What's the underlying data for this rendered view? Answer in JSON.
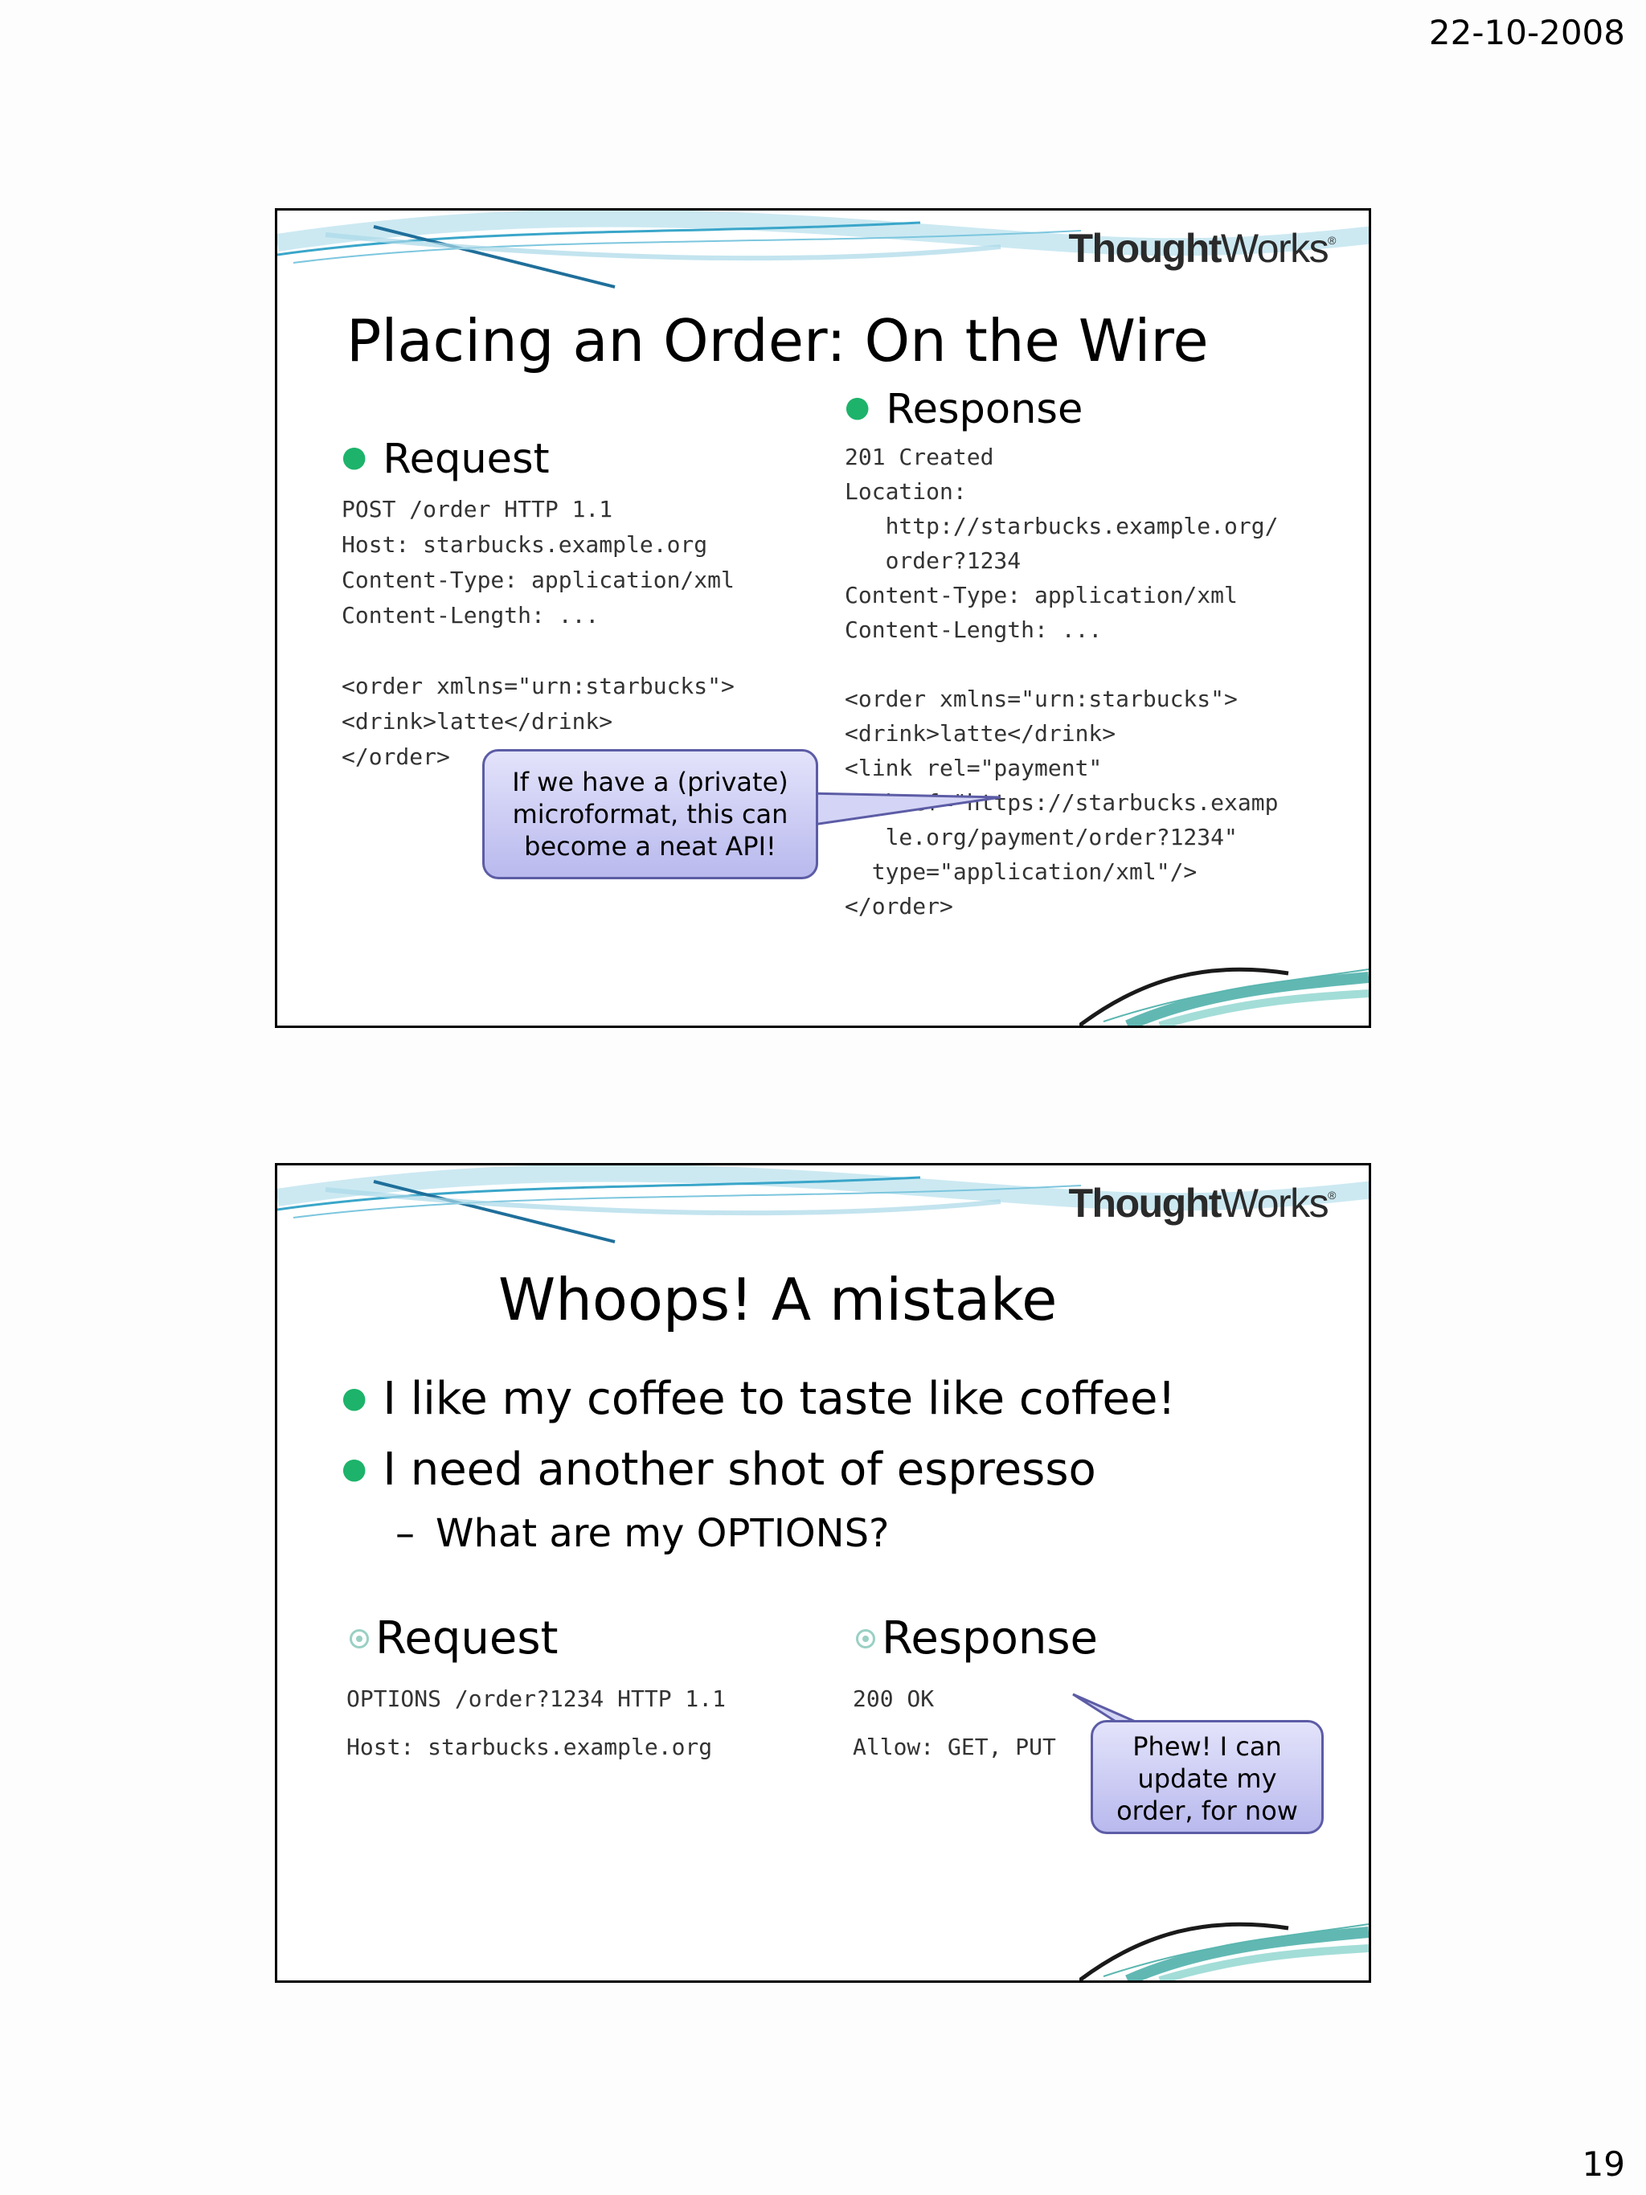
{
  "page": {
    "date": "22-10-2008",
    "number": "19"
  },
  "slide1": {
    "logo": {
      "bold": "Thought",
      "regular": "Works"
    },
    "title": "Placing an Order: On the Wire",
    "request": {
      "label": "Request",
      "code": "POST /order HTTP 1.1\nHost: starbucks.example.org\nContent-Type: application/xml\nContent-Length: ...\n\n<order xmlns=\"urn:starbucks\">\n<drink>latte</drink>\n</order>"
    },
    "response": {
      "label": "Response",
      "code": "201 Created\nLocation:\n   http://starbucks.example.org/\n   order?1234\nContent-Type: application/xml\nContent-Length: ...\n\n<order xmlns=\"urn:starbucks\">\n<drink>latte</drink>\n<link rel=\"payment\"\n   href=\"https://starbucks.examp\n   le.org/payment/order?1234\"\n  type=\"application/xml\"/>\n</order>"
    },
    "callout": [
      "If we have a (private)",
      "microformat, this can",
      "become a neat API!"
    ]
  },
  "slide2": {
    "logo": {
      "bold": "Thought",
      "regular": "Works"
    },
    "title": "Whoops! A mistake",
    "bullets": [
      "I like my coffee to taste like coffee!",
      "I need another shot of espresso"
    ],
    "sub_bullet": "What are my OPTIONS?",
    "request": {
      "label": "Request",
      "line1": "OPTIONS /order?1234 HTTP 1.1",
      "line2": "Host: starbucks.example.org"
    },
    "response": {
      "label": "Response",
      "line1": "200 OK",
      "line2": "Allow: GET, PUT"
    },
    "callout": [
      "Phew! I can",
      "update my",
      "order, for now"
    ]
  },
  "colors": {
    "bullet": "#1db36a",
    "callout_fill": "#c8c8f4",
    "callout_border": "#5c5ca6",
    "swoosh": "#3aa6c9"
  }
}
